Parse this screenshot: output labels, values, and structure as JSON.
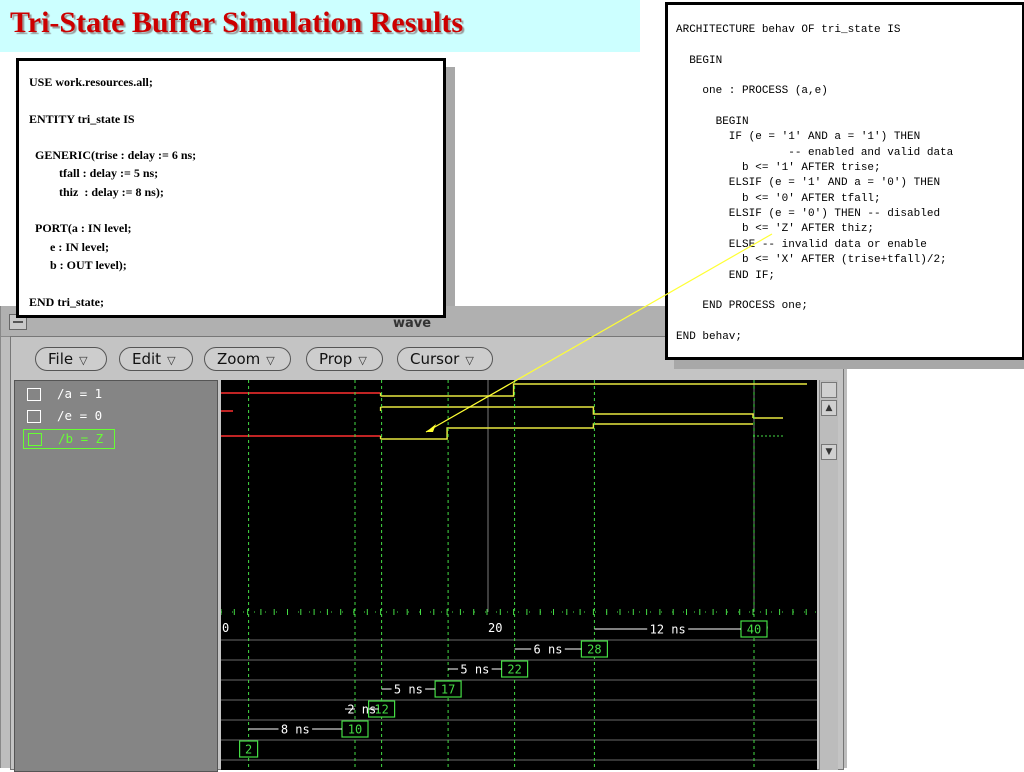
{
  "slide_title": "Tri-State Buffer Simulation Results",
  "entity_code": "USE work.resources.all;\n\nENTITY tri_state IS\n\n  GENERIC(trise : delay := 6 ns;\n          tfall : delay := 5 ns;\n          thiz  : delay := 8 ns);\n\n  PORT(a : IN level;\n       e : IN level;\n       b : OUT level);\n\nEND tri_state;",
  "arch_code": "ARCHITECTURE behav OF tri_state IS\n\n  BEGIN\n\n    one : PROCESS (a,e)\n\n      BEGIN\n        IF (e = '1' AND a = '1') THEN\n                 -- enabled and valid data\n          b <= '1' AFTER trise;\n        ELSIF (e = '1' AND a = '0') THEN\n          b <= '0' AFTER tfall;\n        ELSIF (e = '0') THEN -- disabled\n          b <= 'Z' AFTER thiz;\n        ELSE -- invalid data or enable\n          b <= 'X' AFTER (trise+tfall)/2;\n        END IF;\n\n    END PROCESS one;\n\nEND behav;",
  "wave_window": {
    "title": "wave",
    "menus": [
      {
        "label": "File",
        "arrow": "▽"
      },
      {
        "label": "Edit",
        "arrow": "▽"
      },
      {
        "label": "Zoom",
        "arrow": "▽"
      },
      {
        "label": "Prop",
        "arrow": "▽"
      },
      {
        "label": "Cursor",
        "arrow": "▽"
      }
    ],
    "signals": [
      {
        "label": "/a = 1",
        "selected": false
      },
      {
        "label": "/e = 0",
        "selected": false
      },
      {
        "label": "/b = Z",
        "selected": true
      }
    ],
    "time_axis_labels": [
      "0",
      "20",
      "40"
    ],
    "cursors": [
      {
        "time": "2",
        "delta": ""
      },
      {
        "time": "10",
        "delta": "8 ns"
      },
      {
        "time": "12",
        "delta": "2 ns"
      },
      {
        "time": "17",
        "delta": "5 ns"
      },
      {
        "time": "22",
        "delta": "5 ns"
      },
      {
        "time": "28",
        "delta": "6 ns"
      },
      {
        "time": "40",
        "delta": "12 ns"
      }
    ]
  },
  "colors": {
    "title": "#cc0000",
    "title_band": "#ccffff",
    "wave_signal": "#e8e840",
    "wave_initial": "#ff3030",
    "cursor": "#44dd44",
    "pointer": "#ffff33",
    "selected": "#66ff33"
  }
}
